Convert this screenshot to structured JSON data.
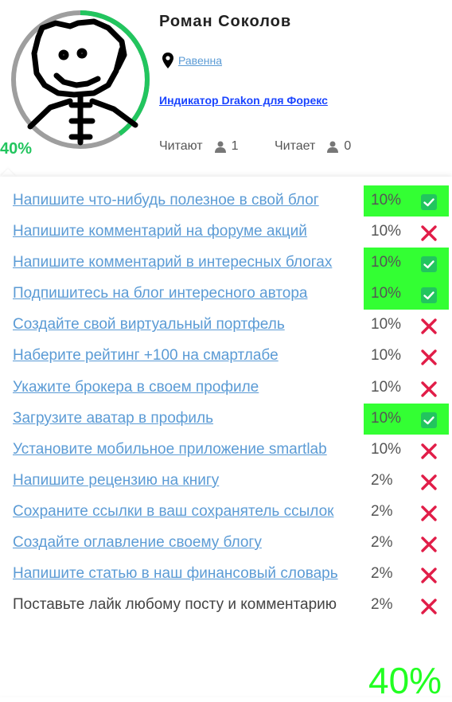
{
  "profile": {
    "name": "Роман Соколов",
    "location": "Равенна",
    "link": "Индикатор Drakon для Форекс",
    "progress_label": "40%",
    "progress_fraction": 0.4,
    "followers_label": "Читают",
    "followers_count": "1",
    "following_label": "Читает",
    "following_count": "0"
  },
  "tasks": [
    {
      "label": "Напишите что-нибудь полезное в свой блог",
      "percent": "10%",
      "done": true
    },
    {
      "label": "Напишите комментарий на форуме акций",
      "percent": "10%",
      "done": false
    },
    {
      "label": "Напишите комментарий в интересных блогах",
      "percent": "10%",
      "done": true
    },
    {
      "label": "Подпишитесь на блог интересного автора",
      "percent": "10%",
      "done": true
    },
    {
      "label": "Создайте свой виртуальный портфель",
      "percent": "10%",
      "done": false
    },
    {
      "label": "Наберите рейтинг +100 на смартлабе",
      "percent": "10%",
      "done": false
    },
    {
      "label": "Укажите брокера в своем профиле",
      "percent": "10%",
      "done": false
    },
    {
      "label": "Загрузите аватар в профиль",
      "percent": "10%",
      "done": true
    },
    {
      "label": "Установите мобильное приложение smartlab",
      "percent": "10%",
      "done": false
    },
    {
      "label": "Напишите рецензию на книгу",
      "percent": "2%",
      "done": false
    },
    {
      "label": "Сохраните ссылки в ваш сохранятель ссылок",
      "percent": "2%",
      "done": false
    },
    {
      "label": "Создайте оглавление своему блогу",
      "percent": "2%",
      "done": false
    },
    {
      "label": "Напишите статью в наш финансовый словарь",
      "percent": "2%",
      "done": false
    },
    {
      "label": "Поставьте лайк любому посту и комментарию",
      "percent": "2%",
      "done": false,
      "plain": true
    }
  ],
  "total_label": "40%",
  "colors": {
    "progress": "#22c55e",
    "done_highlight": "#33ff33",
    "check": "#22c55e",
    "cross": "#e11d48",
    "link": "#5b9bd5"
  }
}
